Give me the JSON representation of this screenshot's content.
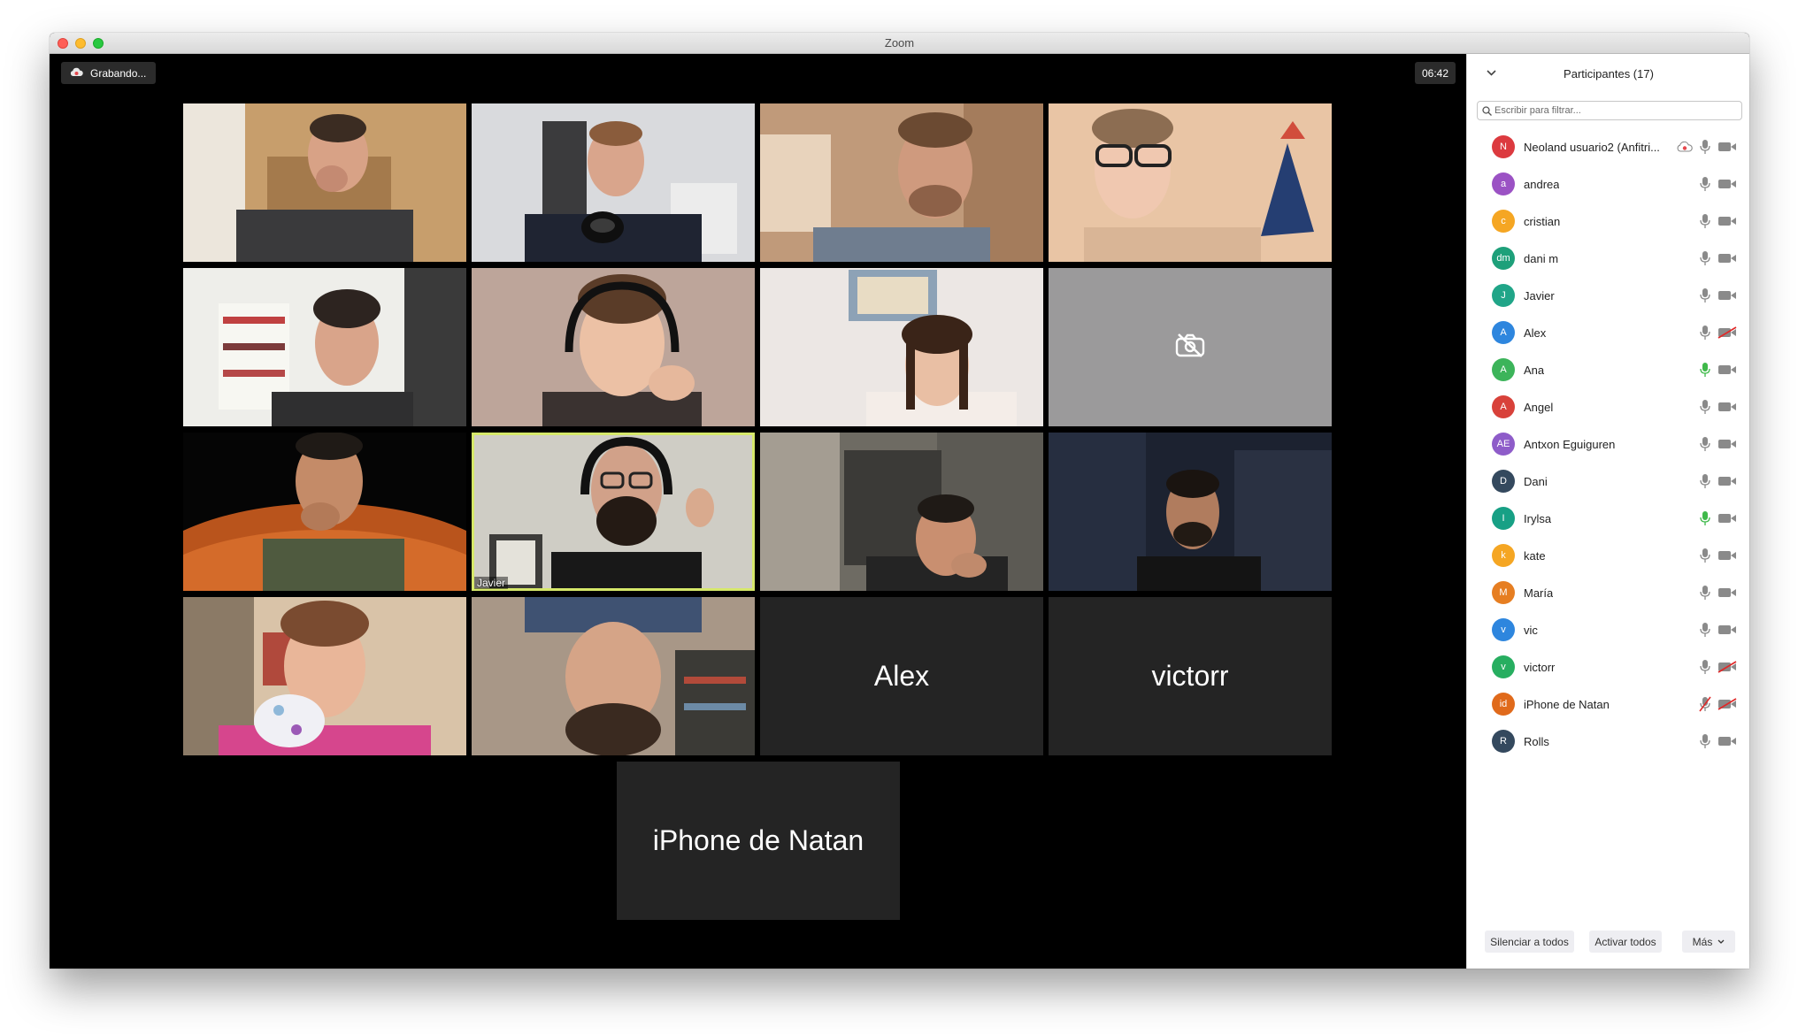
{
  "window": {
    "title": "Zoom"
  },
  "toolbar": {
    "recording_label": "Grabando...",
    "timer": "06:42"
  },
  "colors": {
    "active_speaker_border": "#d6e86a",
    "mic_active": "#3fb94a",
    "muted_red": "#e02828"
  },
  "video_tiles": [
    {
      "type": "video",
      "scene": "man laughing, wooden room"
    },
    {
      "type": "video",
      "scene": "man smiling with microphone"
    },
    {
      "type": "video",
      "scene": "man with hand on head"
    },
    {
      "type": "video",
      "scene": "woman with glasses and earphones"
    },
    {
      "type": "video",
      "scene": "man smiling in front of bookshelf"
    },
    {
      "type": "video",
      "scene": "woman with headphones smiling"
    },
    {
      "type": "video",
      "scene": "woman smiling, painting on wall"
    },
    {
      "type": "camera_off",
      "icon": "camera-off-icon"
    },
    {
      "type": "video",
      "scene": "man with space background"
    },
    {
      "type": "video",
      "scene": "bearded man with headphones",
      "name_label": "Javier",
      "active": true
    },
    {
      "type": "video",
      "scene": "man in dark room"
    },
    {
      "type": "video",
      "scene": "bearded man on phone"
    },
    {
      "type": "video",
      "scene": "woman laughing with hand on mouth"
    },
    {
      "type": "video",
      "scene": "upside down face"
    },
    {
      "type": "name",
      "name": "Alex"
    },
    {
      "type": "name",
      "name": "victorr"
    },
    {
      "type": "name",
      "name": "iPhone de Natan"
    }
  ],
  "participants_panel": {
    "title": "Participantes (17)",
    "search_placeholder": "Escribir para filtrar...",
    "participants": [
      {
        "initials": "N",
        "name": "Neoland usuario2 (Anfitri...",
        "avatar_color": "#dc3a3f",
        "recording": true,
        "mic": "muted",
        "video": "on"
      },
      {
        "initials": "a",
        "name": "andrea",
        "avatar_color": "#9b52c4",
        "mic": "muted",
        "video": "on"
      },
      {
        "initials": "c",
        "name": "cristian",
        "avatar_color": "#f5a623",
        "mic": "muted",
        "video": "on"
      },
      {
        "initials": "dm",
        "name": "dani m",
        "avatar_color": "#1ea07a",
        "mic": "muted",
        "video": "on"
      },
      {
        "initials": "J",
        "name": "Javier",
        "avatar_color": "#20a588",
        "mic": "muted",
        "video": "on"
      },
      {
        "initials": "A",
        "name": "Alex",
        "avatar_color": "#2e86de",
        "mic": "muted",
        "video": "off"
      },
      {
        "initials": "A",
        "name": "Ana",
        "avatar_color": "#3cb45a",
        "mic": "active",
        "video": "on"
      },
      {
        "initials": "A",
        "name": "Angel",
        "avatar_color": "#d8413a",
        "mic": "muted",
        "video": "on"
      },
      {
        "initials": "AE",
        "name": "Antxon Eguiguren",
        "avatar_color": "#8e5cc9",
        "mic": "muted",
        "video": "on"
      },
      {
        "initials": "D",
        "name": "Dani",
        "avatar_color": "#34495e",
        "mic": "muted",
        "video": "on"
      },
      {
        "initials": "I",
        "name": "Irylsa",
        "avatar_color": "#17a085",
        "mic": "active",
        "video": "on"
      },
      {
        "initials": "k",
        "name": "kate",
        "avatar_color": "#f5a623",
        "mic": "muted",
        "video": "on"
      },
      {
        "initials": "M",
        "name": "María",
        "avatar_color": "#e67e22",
        "mic": "muted",
        "video": "on"
      },
      {
        "initials": "v",
        "name": "vic",
        "avatar_color": "#2e86de",
        "mic": "muted",
        "video": "on"
      },
      {
        "initials": "v",
        "name": "victorr",
        "avatar_color": "#27ae60",
        "mic": "muted",
        "video": "off"
      },
      {
        "initials": "id",
        "name": "iPhone de Natan",
        "avatar_color": "#e06a1b",
        "mic": "off",
        "video": "off"
      },
      {
        "initials": "R",
        "name": "Rolls",
        "avatar_color": "#34495e",
        "mic": "muted",
        "video": "on"
      }
    ],
    "footer": {
      "mute_all": "Silenciar a todos",
      "unmute_all": "Activar todos",
      "more": "Más"
    }
  }
}
